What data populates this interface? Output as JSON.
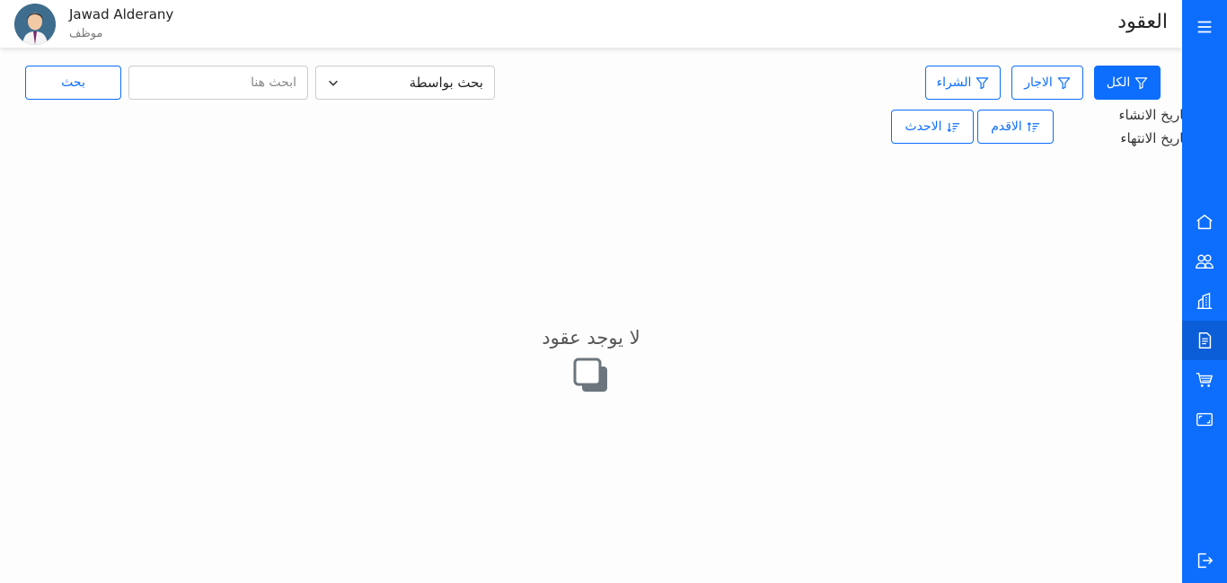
{
  "header": {
    "title": "العقود",
    "user_name": "Jawad Alderany",
    "user_role": "موظف"
  },
  "filters": {
    "all_label": "الكل",
    "rent_label": "الاجار",
    "purchase_label": "الشراء",
    "newest_label": "الاحدث",
    "oldest_label": "الاقدم"
  },
  "sort_by": {
    "created_label": "تاريخ الانشاء",
    "ended_label": "تاريخ الانتهاء"
  },
  "search": {
    "by_label": "بحث بواسطة",
    "placeholder": "ابحث هنا",
    "button_label": "بحث"
  },
  "empty_state": {
    "message": "لا يوجد عقود"
  },
  "sidebar": {
    "items": [
      "menu-icon",
      "home-icon",
      "users-icon",
      "building-icon",
      "contract-icon",
      "cart-icon",
      "fullscreen-icon",
      "logout-icon"
    ],
    "active": "contract-icon"
  },
  "colors": {
    "primary": "#0d6efd",
    "sidebar_active": "#0b5ed7"
  }
}
